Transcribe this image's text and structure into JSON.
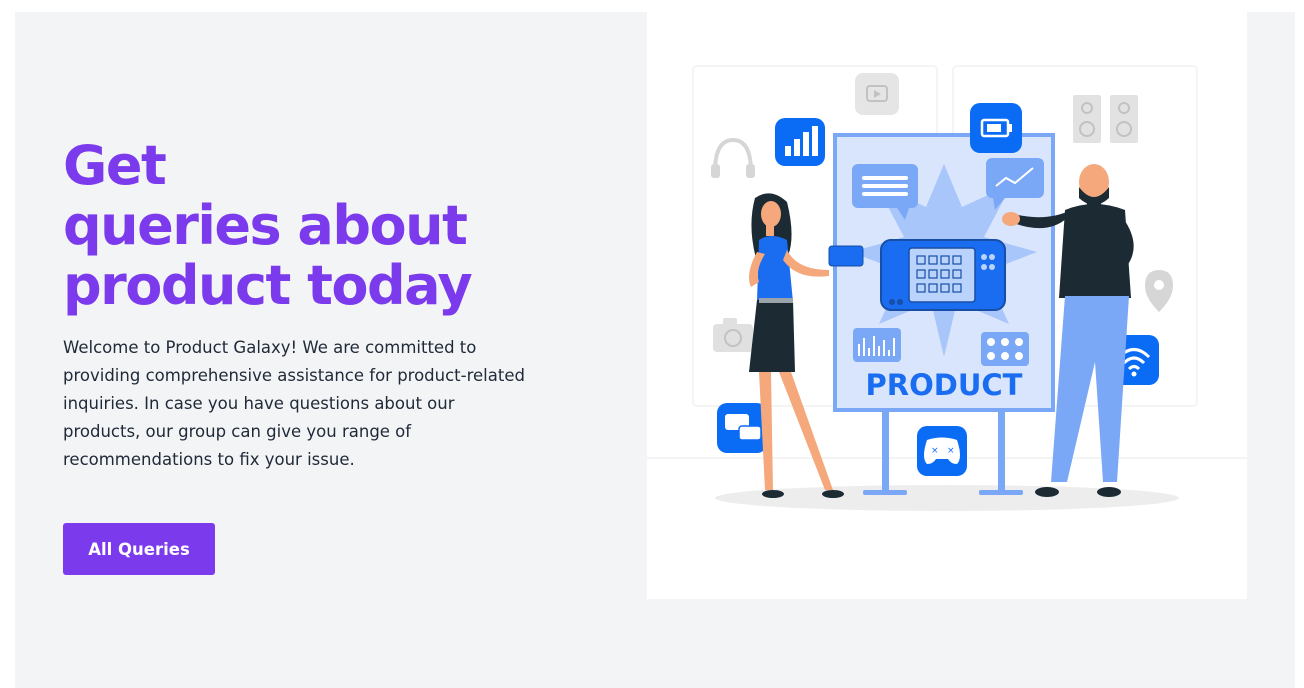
{
  "hero": {
    "headline": {
      "line1": "Get",
      "line2": "queries about",
      "line3": "product today"
    },
    "intro": "Welcome to Product Galaxy! We are committed to providing comprehensive assistance for product-related inquiries. In case you have questions about our products, our group can give you range of recommendations to fix your issue.",
    "cta_label": "All Queries"
  },
  "illustration": {
    "board_text": "PRODUCT",
    "icons": [
      "youtube-icon",
      "headphones-icon",
      "bar-chart-icon",
      "battery-icon",
      "speakers-icon",
      "camera-icon",
      "location-pin-icon",
      "wifi-icon",
      "chat-icon",
      "gamepad-icon"
    ]
  },
  "colors": {
    "accent": "#7c3aed",
    "illustration_blue": "#0a6cf5",
    "background": "#f3f4f6"
  }
}
